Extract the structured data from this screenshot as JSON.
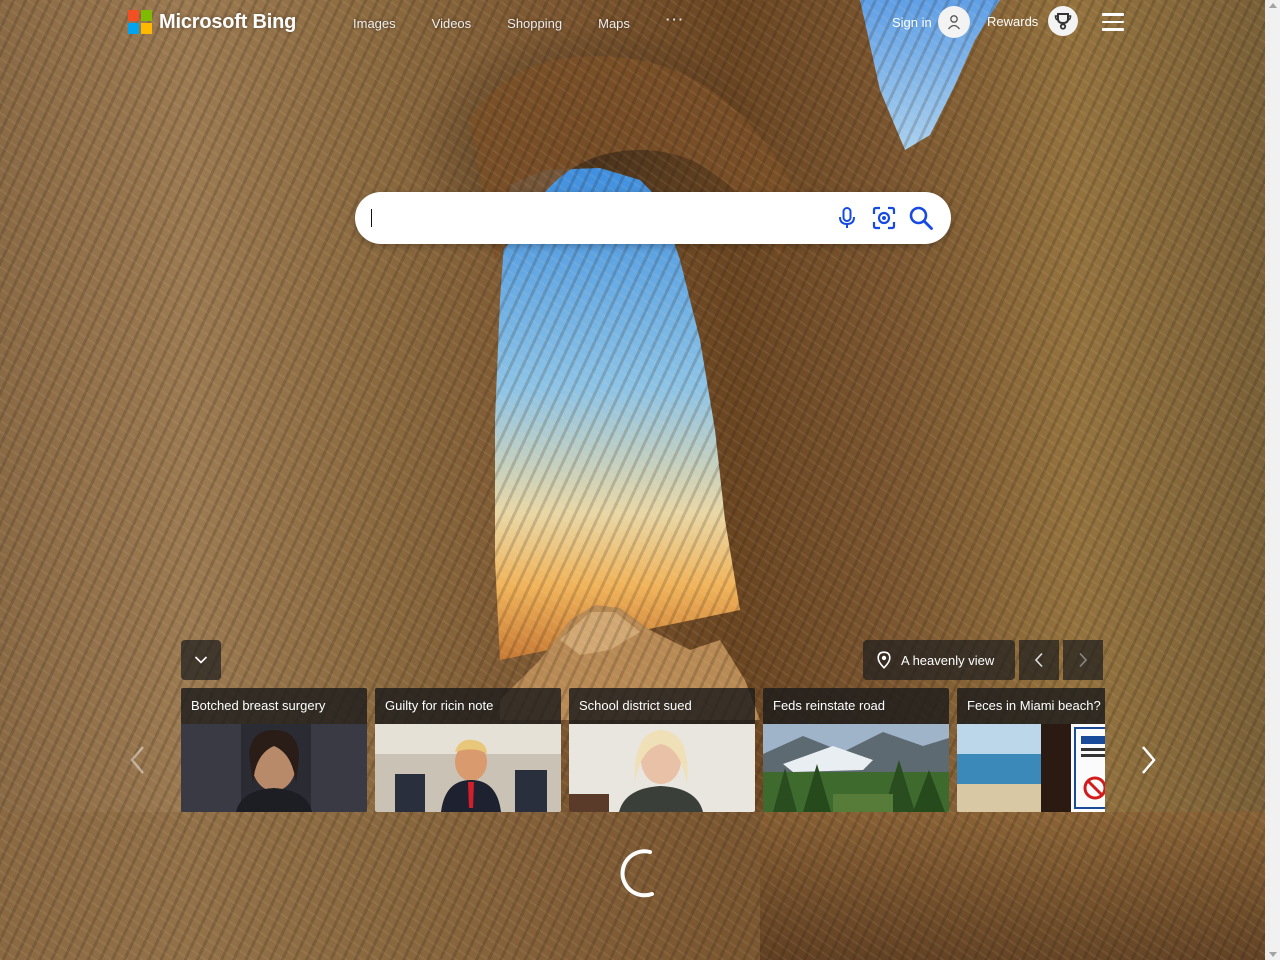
{
  "brand": {
    "name": "Microsoft Bing",
    "colors": [
      "#f25022",
      "#7fba00",
      "#00a4ef",
      "#ffb900"
    ]
  },
  "nav": {
    "items": [
      "Images",
      "Videos",
      "Shopping",
      "Maps"
    ],
    "more": "···"
  },
  "account": {
    "signin_label": "Sign in",
    "rewards_label": "Rewards"
  },
  "search": {
    "value": "",
    "placeholder": "",
    "icons": [
      "microphone-icon",
      "visual-search-icon",
      "search-icon"
    ]
  },
  "image_of_day": {
    "caption": "A heavenly view"
  },
  "news_cards": [
    {
      "title": "Botched breast surgery"
    },
    {
      "title": "Guilty for ricin note"
    },
    {
      "title": "School district sued"
    },
    {
      "title": "Feds reinstate road"
    },
    {
      "title": "Feces in Miami beach?"
    }
  ],
  "accent_color": "#174ae4"
}
